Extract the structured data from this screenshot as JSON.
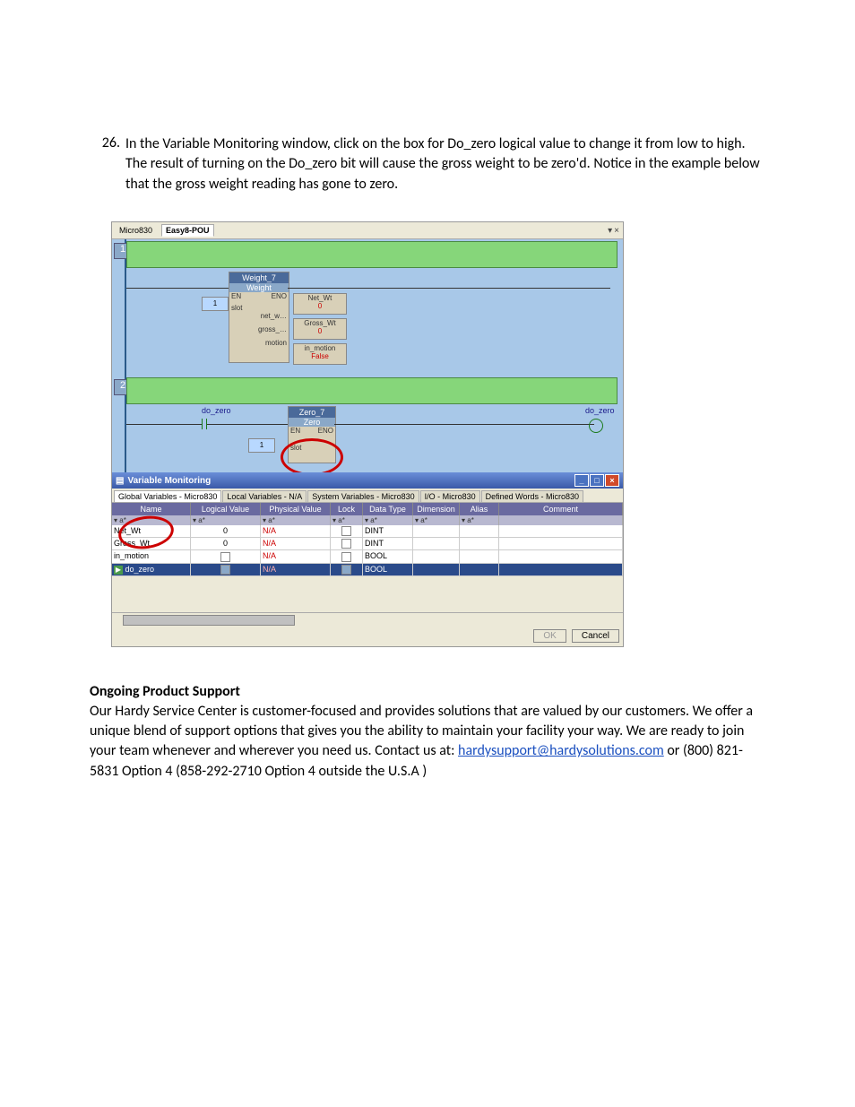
{
  "step": {
    "number": "26.",
    "text": "In the Variable Monitoring window, click on the box for Do_zero logical value to change it from low to high.  The result of turning on the Do_zero bit will cause the gross weight to be zero'd.  Notice in the example below that the gross weight reading has gone to zero."
  },
  "editor": {
    "tab1": "Micro830",
    "tab2": "Easy8-POU",
    "close": "×",
    "dropdown": "▾"
  },
  "ladder": {
    "rung1": "1",
    "rung2": "2",
    "block1_title": "Weight_7",
    "block1_sub": "Weight",
    "en": "EN",
    "eno": "ENO",
    "slot": "slot",
    "slot_val": "1",
    "net_w": "net_w…",
    "gross": "gross_…",
    "motion": "motion",
    "netwt_lbl": "Net_Wt",
    "netwt_val": "0",
    "gross_lbl": "Gross_Wt",
    "gross_val": "0",
    "inmotion_lbl": "in_motion",
    "inmotion_val": "False",
    "do_zero_left": "do_zero",
    "block2_title": "Zero_7",
    "block2_sub": "Zero",
    "do_zero_right": "do_zero"
  },
  "vm": {
    "title": "Variable Monitoring",
    "tabs": {
      "t1": "Global Variables - Micro830",
      "t2": "Local Variables - N/A",
      "t3": "System Variables - Micro830",
      "t4": "I/O - Micro830",
      "t5": "Defined Words - Micro830"
    },
    "headers": {
      "name": "Name",
      "lv": "Logical Value",
      "pv": "Physical Value",
      "lock": "Lock",
      "dt": "Data Type",
      "dim": "Dimension",
      "alias": "Alias",
      "comment": "Comment"
    },
    "filter": "▾ a*",
    "rows": [
      {
        "name": "Net_Wt",
        "lv": "0",
        "pv": "N/A",
        "lock": "",
        "dt": "DINT"
      },
      {
        "name": "Gross_Wt",
        "lv": "0",
        "pv": "N/A",
        "lock": "",
        "dt": "DINT"
      },
      {
        "name": "in_motion",
        "lv": "☐",
        "pv": "N/A",
        "lock": "",
        "dt": "BOOL"
      },
      {
        "name": "do_zero",
        "lv": "☑",
        "pv": "N/A",
        "lock": "☑",
        "dt": "BOOL",
        "sel": true
      }
    ],
    "ok": "OK",
    "cancel": "Cancel"
  },
  "support": {
    "heading": "Ongoing Product Support",
    "text1": "Our Hardy Service Center is customer-focused and provides solutions that are valued by our customers. We offer a unique blend of support options that gives you the ability to maintain your facility your way. We are ready to join your team whenever and wherever you need us. Contact us at:  ",
    "email": "hardysupport@hardysolutions.com",
    "text2": " or (800) 821-5831 Option 4 (858-292-2710 Option 4 outside the U.S.A )"
  }
}
